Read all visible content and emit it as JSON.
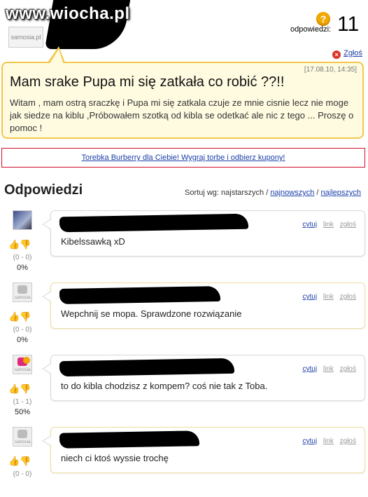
{
  "header": {
    "watermark": "www.wiocha.pl",
    "avatar_label": "samosia.pl",
    "answers_label": "odpowiedzi:",
    "answers_count": "11"
  },
  "report_label": "Zgłoś",
  "question": {
    "date": "[17.08.10, 14:35]",
    "title": "Mam srake Pupa mi się zatkała co robić ??!!",
    "body": "Witam , mam ostrą sraczkę i Pupa mi się zatkala czuje ze mnie cisnie lecz nie moge jak siedze na kiblu ,Próbowałem szotką od kibla se odetkać ale nic z tego ... Proszę o pomoc !"
  },
  "ad": {
    "text": "Torebka Burberry dla Ciebie! Wygraj torbe i odbierz kupony!"
  },
  "answers_section": {
    "title": "Odpowiedzi",
    "sort_prefix": "Sortuj wg:",
    "sort_oldest": "najstarszych",
    "sort_newest": "najnowszych",
    "sort_best": "najlepszych",
    "sep": "/"
  },
  "answer_actions": {
    "cite": "cytuj",
    "link": "link",
    "report": "zgłoś"
  },
  "answers": [
    {
      "text": "Kibelssawką xD",
      "votes": "(0 - 0)",
      "percent": "0%",
      "avatar": "photo"
    },
    {
      "text": "Wepchnij se mopa. Sprawdzone rozwiązanie",
      "votes": "(0 - 0)",
      "percent": "0%",
      "avatar": "gray"
    },
    {
      "text": "to do kibla chodzisz z kompem? coś nie tak z Toba.",
      "votes": "(1 - 1)",
      "percent": "50%",
      "avatar": "color"
    },
    {
      "text": "niech ci ktoś wyssie trochę",
      "votes": "(0 - 0)",
      "percent": "",
      "avatar": "gray"
    }
  ],
  "colors": {
    "accent_yellow": "#f3c649",
    "link_blue": "#1a3ea8",
    "ad_border": "#d0112b"
  }
}
